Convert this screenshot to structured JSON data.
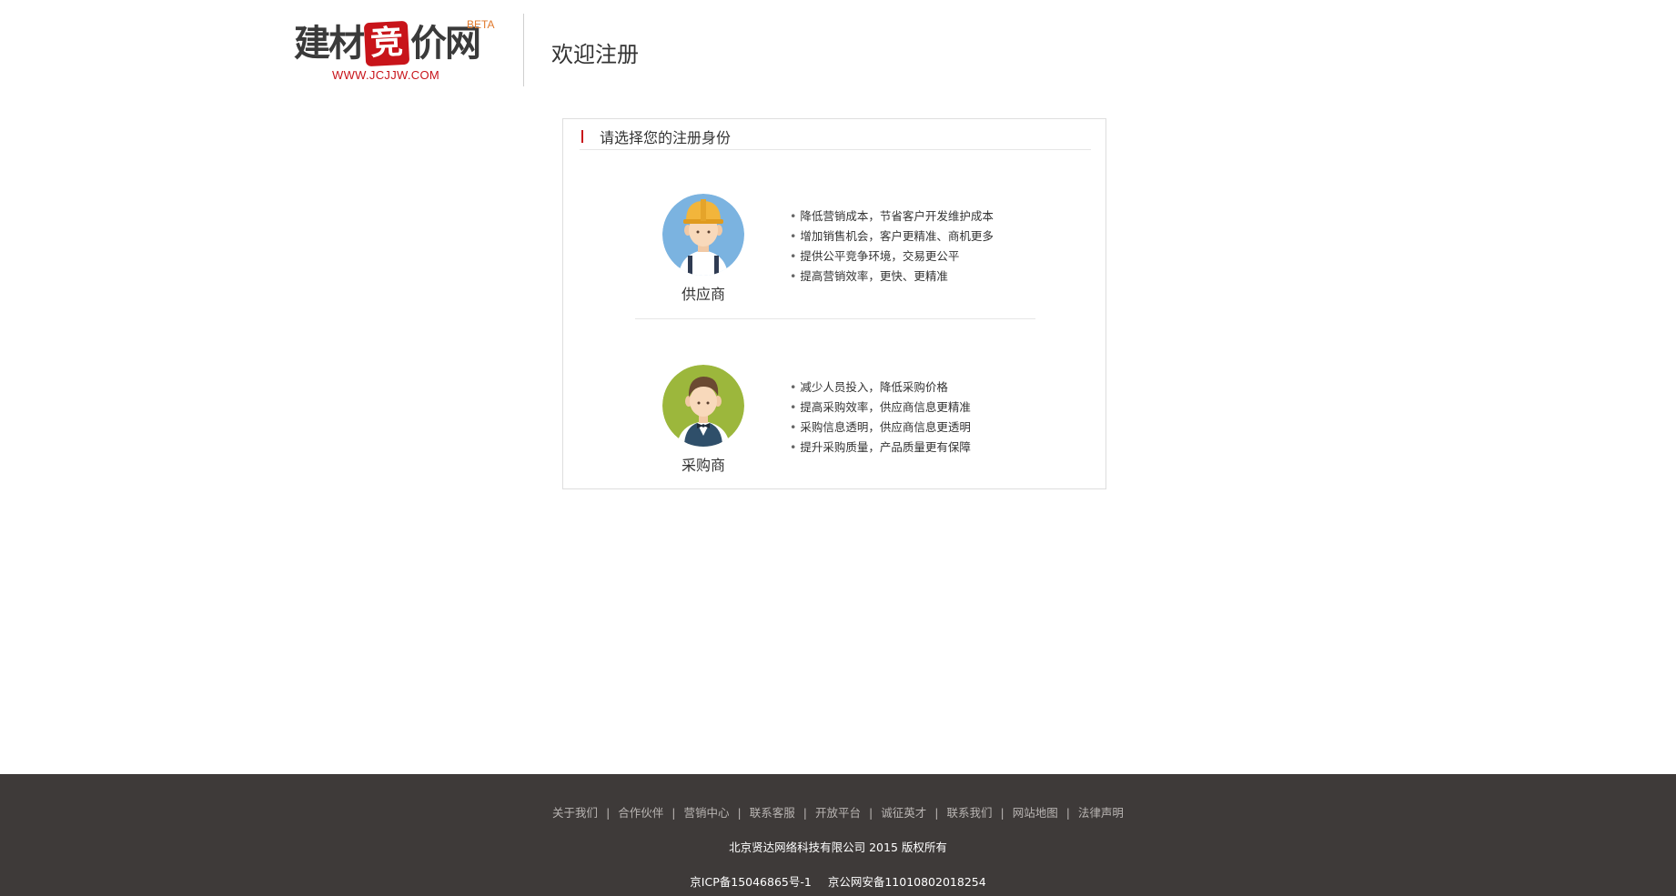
{
  "header": {
    "logo": {
      "char1": "建",
      "char2": "材",
      "seal": "竞",
      "char3": "价",
      "char4": "网",
      "beta": "BETA",
      "url": "WWW.JCJJW.COM"
    },
    "page_title": "欢迎注册"
  },
  "register": {
    "heading": "请选择您的注册身份",
    "roles": [
      {
        "name": "供应商",
        "avatar_icon": "worker-avatar-icon",
        "benefits": [
          "降低营销成本，节省客户开发维护成本",
          "增加销售机会，客户更精准、商机更多",
          "提供公平竞争环境，交易更公平",
          "提高营销效率，更快、更精准"
        ]
      },
      {
        "name": "采购商",
        "avatar_icon": "buyer-avatar-icon",
        "benefits": [
          "减少人员投入，降低采购价格",
          "提高采购效率，供应商信息更精准",
          "采购信息透明，供应商信息更透明",
          "提升采购质量，产品质量更有保障"
        ]
      }
    ]
  },
  "footer": {
    "links": [
      "关于我们",
      "合作伙伴",
      "营销中心",
      "联系客服",
      "开放平台",
      "诚征英才",
      "联系我们",
      "网站地图",
      "法律声明"
    ],
    "separator": "|",
    "copyright": "北京贤达网络科技有限公司 2015 版权所有",
    "icp": "京ICP备15046865号-1",
    "police": "京公网安备11010802018254"
  },
  "colors": {
    "brand_red": "#c8141a",
    "footer_bg": "#3e3a39",
    "supplier_avatar_bg": "#7bb3e0",
    "buyer_avatar_bg": "#9cb73c"
  }
}
